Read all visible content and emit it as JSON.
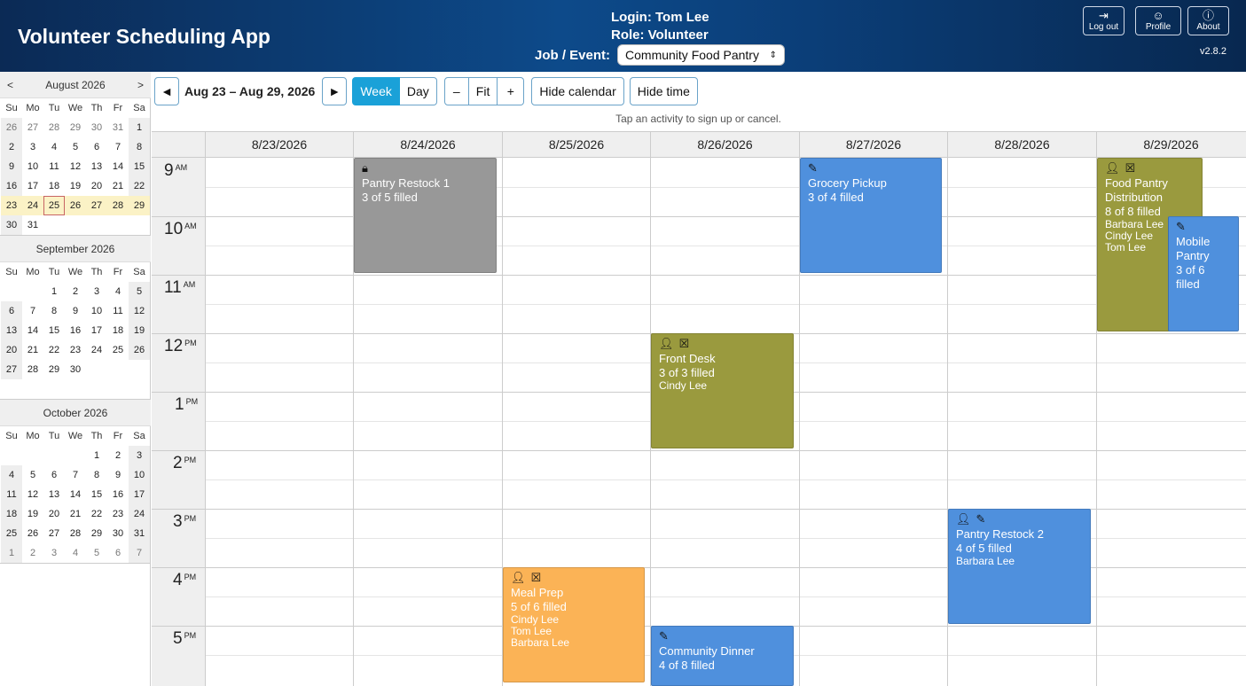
{
  "header": {
    "app_title": "Volunteer Scheduling App",
    "login": "Login: Tom Lee",
    "role": "Role: Volunteer",
    "job_label": "Job / Event:",
    "job_value": "Community Food Pantry",
    "logout_label": "Log out",
    "profile_label": "Profile",
    "about_label": "About",
    "version": "v2.8.2"
  },
  "sidebar": {
    "prev": "<",
    "next": ">",
    "dow": [
      "Su",
      "Mo",
      "Tu",
      "We",
      "Th",
      "Fr",
      "Sa"
    ],
    "months": [
      {
        "title": "August 2026",
        "weeks": [
          [
            "26",
            "27",
            "28",
            "29",
            "30",
            "31",
            "1"
          ],
          [
            "2",
            "3",
            "4",
            "5",
            "6",
            "7",
            "8"
          ],
          [
            "9",
            "10",
            "11",
            "12",
            "13",
            "14",
            "15"
          ],
          [
            "16",
            "17",
            "18",
            "19",
            "20",
            "21",
            "22"
          ],
          [
            "23",
            "24",
            "25",
            "26",
            "27",
            "28",
            "29"
          ],
          [
            "30",
            "31",
            "",
            "",
            "",
            "",
            ""
          ]
        ]
      },
      {
        "title": "September 2026",
        "weeks": [
          [
            "",
            "",
            "1",
            "2",
            "3",
            "4",
            "5"
          ],
          [
            "6",
            "7",
            "8",
            "9",
            "10",
            "11",
            "12"
          ],
          [
            "13",
            "14",
            "15",
            "16",
            "17",
            "18",
            "19"
          ],
          [
            "20",
            "21",
            "22",
            "23",
            "24",
            "25",
            "26"
          ],
          [
            "27",
            "28",
            "29",
            "30",
            "",
            "",
            ""
          ]
        ]
      },
      {
        "title": "October 2026",
        "weeks": [
          [
            "",
            "",
            "",
            "",
            "1",
            "2",
            "3"
          ],
          [
            "4",
            "5",
            "6",
            "7",
            "8",
            "9",
            "10"
          ],
          [
            "11",
            "12",
            "13",
            "14",
            "15",
            "16",
            "17"
          ],
          [
            "18",
            "19",
            "20",
            "21",
            "22",
            "23",
            "24"
          ],
          [
            "25",
            "26",
            "27",
            "28",
            "29",
            "30",
            "31"
          ],
          [
            "1",
            "2",
            "3",
            "4",
            "5",
            "6",
            "7"
          ]
        ]
      }
    ]
  },
  "toolbar": {
    "prev": "◄",
    "range": "Aug 23 – Aug 29, 2026",
    "next": "►",
    "week": "Week",
    "day": "Day",
    "zoom_out": "–",
    "fit": "Fit",
    "zoom_in": "+",
    "hide_calendar": "Hide calendar",
    "hide_time": "Hide time"
  },
  "hint": "Tap an activity to sign up or cancel.",
  "calendar": {
    "days": [
      "8/23/2026",
      "8/24/2026",
      "8/25/2026",
      "8/26/2026",
      "8/27/2026",
      "8/28/2026",
      "8/29/2026"
    ],
    "hours": [
      {
        "h": "9",
        "p": "AM"
      },
      {
        "h": "10",
        "p": "AM"
      },
      {
        "h": "11",
        "p": "AM"
      },
      {
        "h": "12",
        "p": "PM"
      },
      {
        "h": "1",
        "p": "PM"
      },
      {
        "h": "2",
        "p": "PM"
      },
      {
        "h": "3",
        "p": "PM"
      },
      {
        "h": "4",
        "p": "PM"
      },
      {
        "h": "5",
        "p": "PM"
      }
    ],
    "events": [
      {
        "title": "Pantry Restock 1",
        "filled": "3 of 5 filled",
        "names": [],
        "icons": [
          "lock-icon"
        ],
        "color": "#989898"
      },
      {
        "title": "Grocery Pickup",
        "filled": "3 of 4 filled",
        "names": [],
        "icons": [
          "pencil-icon"
        ],
        "color": "#4f90dd"
      },
      {
        "title": "Food Pantry Distribution",
        "filled": "8 of 8 filled",
        "names": [
          "Barbara Lee",
          "Cindy Lee",
          "Tom Lee"
        ],
        "icons": [
          "person-icon",
          "cancel-box-icon"
        ],
        "color": "#9a9a3e"
      },
      {
        "title": "Mobile Pantry",
        "filled": "3 of 6 filled",
        "names": [],
        "icons": [
          "pencil-icon"
        ],
        "color": "#4f90dd"
      },
      {
        "title": "Front Desk",
        "filled": "3 of 3 filled",
        "names": [
          "Cindy Lee"
        ],
        "icons": [
          "person-icon",
          "cancel-box-icon"
        ],
        "color": "#9a9a3e"
      },
      {
        "title": "Pantry Restock 2",
        "filled": "4 of 5 filled",
        "names": [
          "Barbara Lee"
        ],
        "icons": [
          "person-icon",
          "pencil-icon"
        ],
        "color": "#4f90dd"
      },
      {
        "title": "Meal Prep",
        "filled": "5 of 6 filled",
        "names": [
          "Cindy Lee",
          "Tom Lee",
          "Barbara Lee"
        ],
        "icons": [
          "person-icon",
          "cancel-box-icon"
        ],
        "color": "#fbb356"
      },
      {
        "title": "Community Dinner",
        "filled": "4 of 8 filled",
        "names": [],
        "icons": [
          "pencil-icon"
        ],
        "color": "#4f90dd"
      }
    ]
  }
}
